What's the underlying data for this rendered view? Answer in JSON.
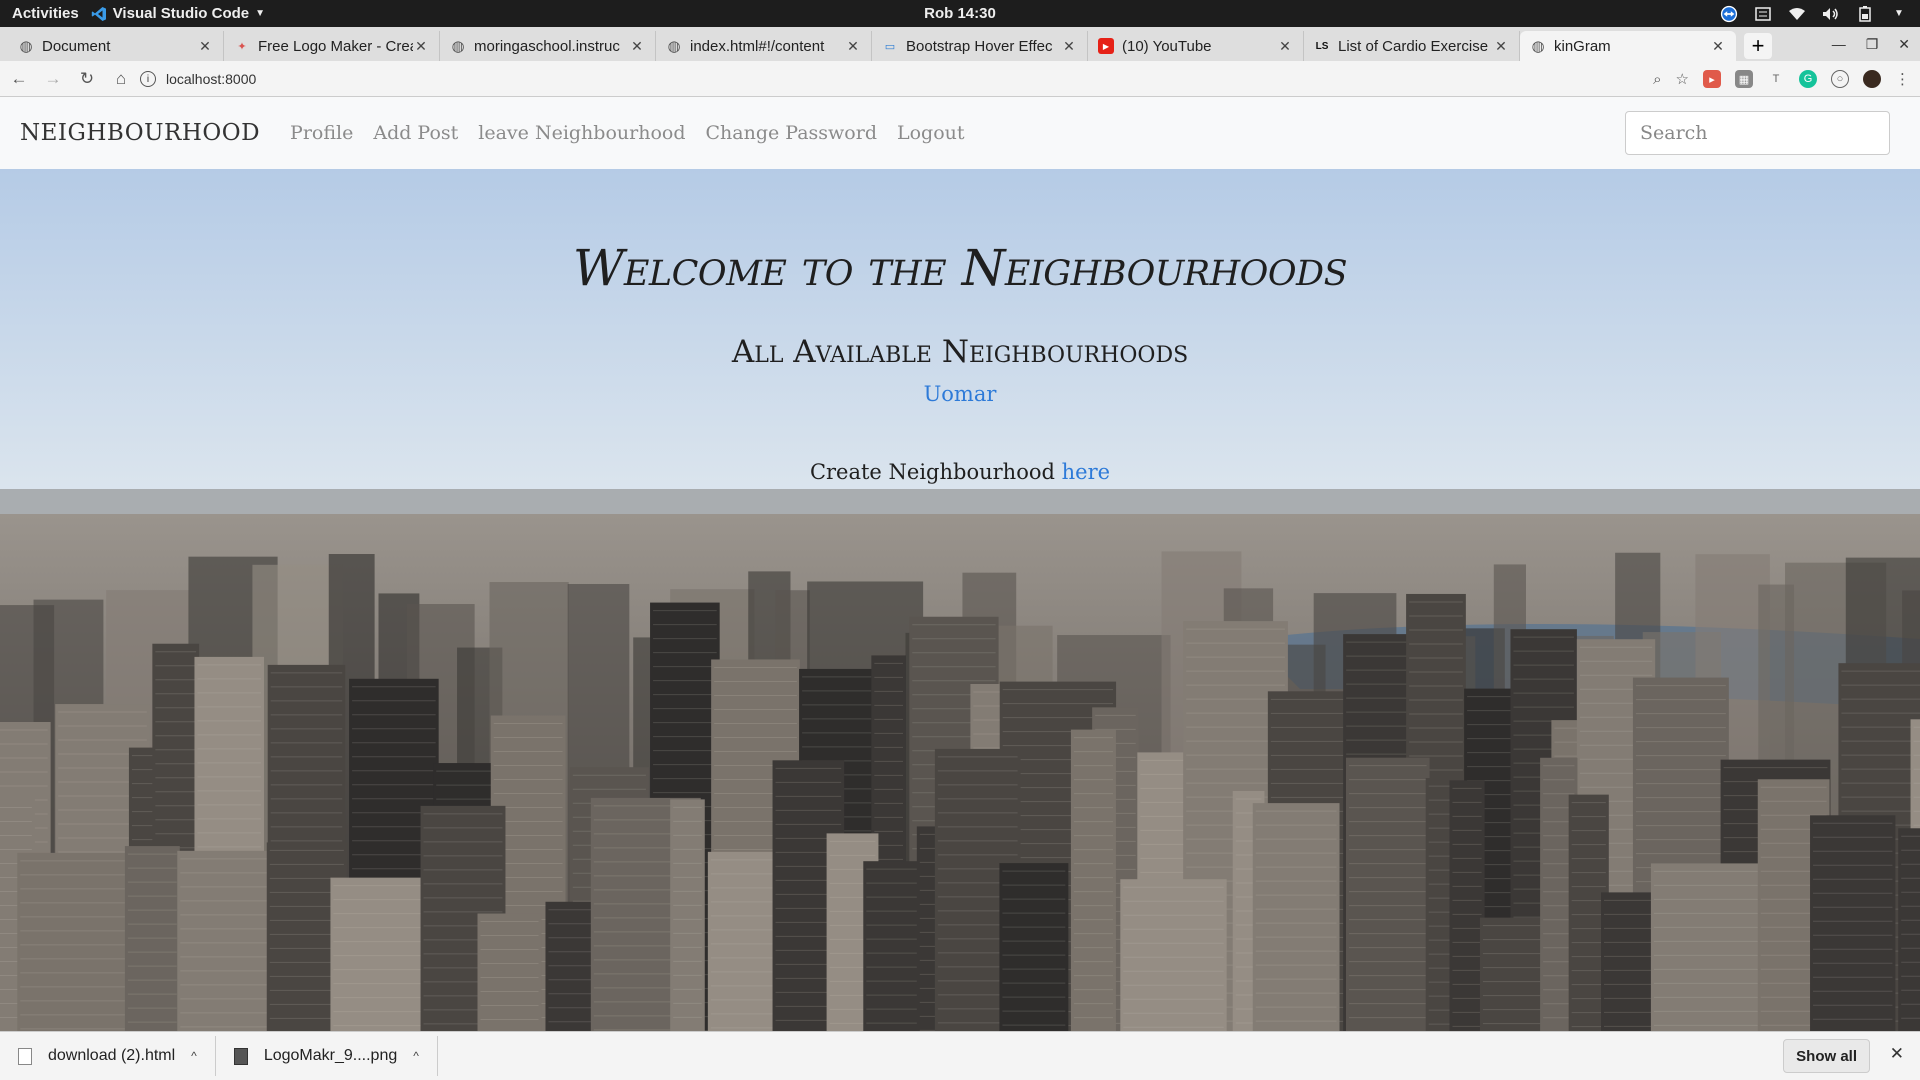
{
  "system_bar": {
    "activities": "Activities",
    "app_name": "Visual Studio Code",
    "clock": "Rob 14:30"
  },
  "tabs": [
    {
      "title": "Document",
      "icon": "globe-icon",
      "active": false
    },
    {
      "title": "Free Logo Maker - Crea",
      "icon": "logo-maker-icon",
      "active": false
    },
    {
      "title": "moringaschool.instruc",
      "icon": "globe-icon",
      "active": false
    },
    {
      "title": "index.html#!/content",
      "icon": "globe-icon",
      "active": false
    },
    {
      "title": "Bootstrap Hover Effec",
      "icon": "bootstrap-icon",
      "active": false
    },
    {
      "title": "(10) YouTube",
      "icon": "youtube-icon",
      "active": false
    },
    {
      "title": "List of Cardio Exercise",
      "icon": "ls-icon",
      "active": false
    },
    {
      "title": "kinGram",
      "icon": "globe-icon",
      "active": true
    }
  ],
  "address_bar": {
    "url": "localhost:8000"
  },
  "navbar": {
    "brand": "NEIGHBOURHOOD",
    "links": [
      "Profile",
      "Add Post",
      "leave Neighbourhood",
      "Change Password",
      "Logout"
    ],
    "search_placeholder": "Search"
  },
  "hero": {
    "welcome": "Welcome to the Neighbourhoods",
    "available": "All Available Neighbourhoods",
    "neighbourhood_link": "Uomar",
    "create_text": "Create Neighbourhood",
    "create_link": "here"
  },
  "downloads": {
    "items": [
      {
        "name": "download (2).html",
        "icon": "html-file-icon"
      },
      {
        "name": "LogoMakr_9....png",
        "icon": "image-file-icon"
      }
    ],
    "show_all": "Show all"
  },
  "colors": {
    "link": "#2d7ad8",
    "navbar_bg": "#f8f9fa",
    "nav_link": "#8b8b8b",
    "system_bar": "#1d1d1d"
  }
}
